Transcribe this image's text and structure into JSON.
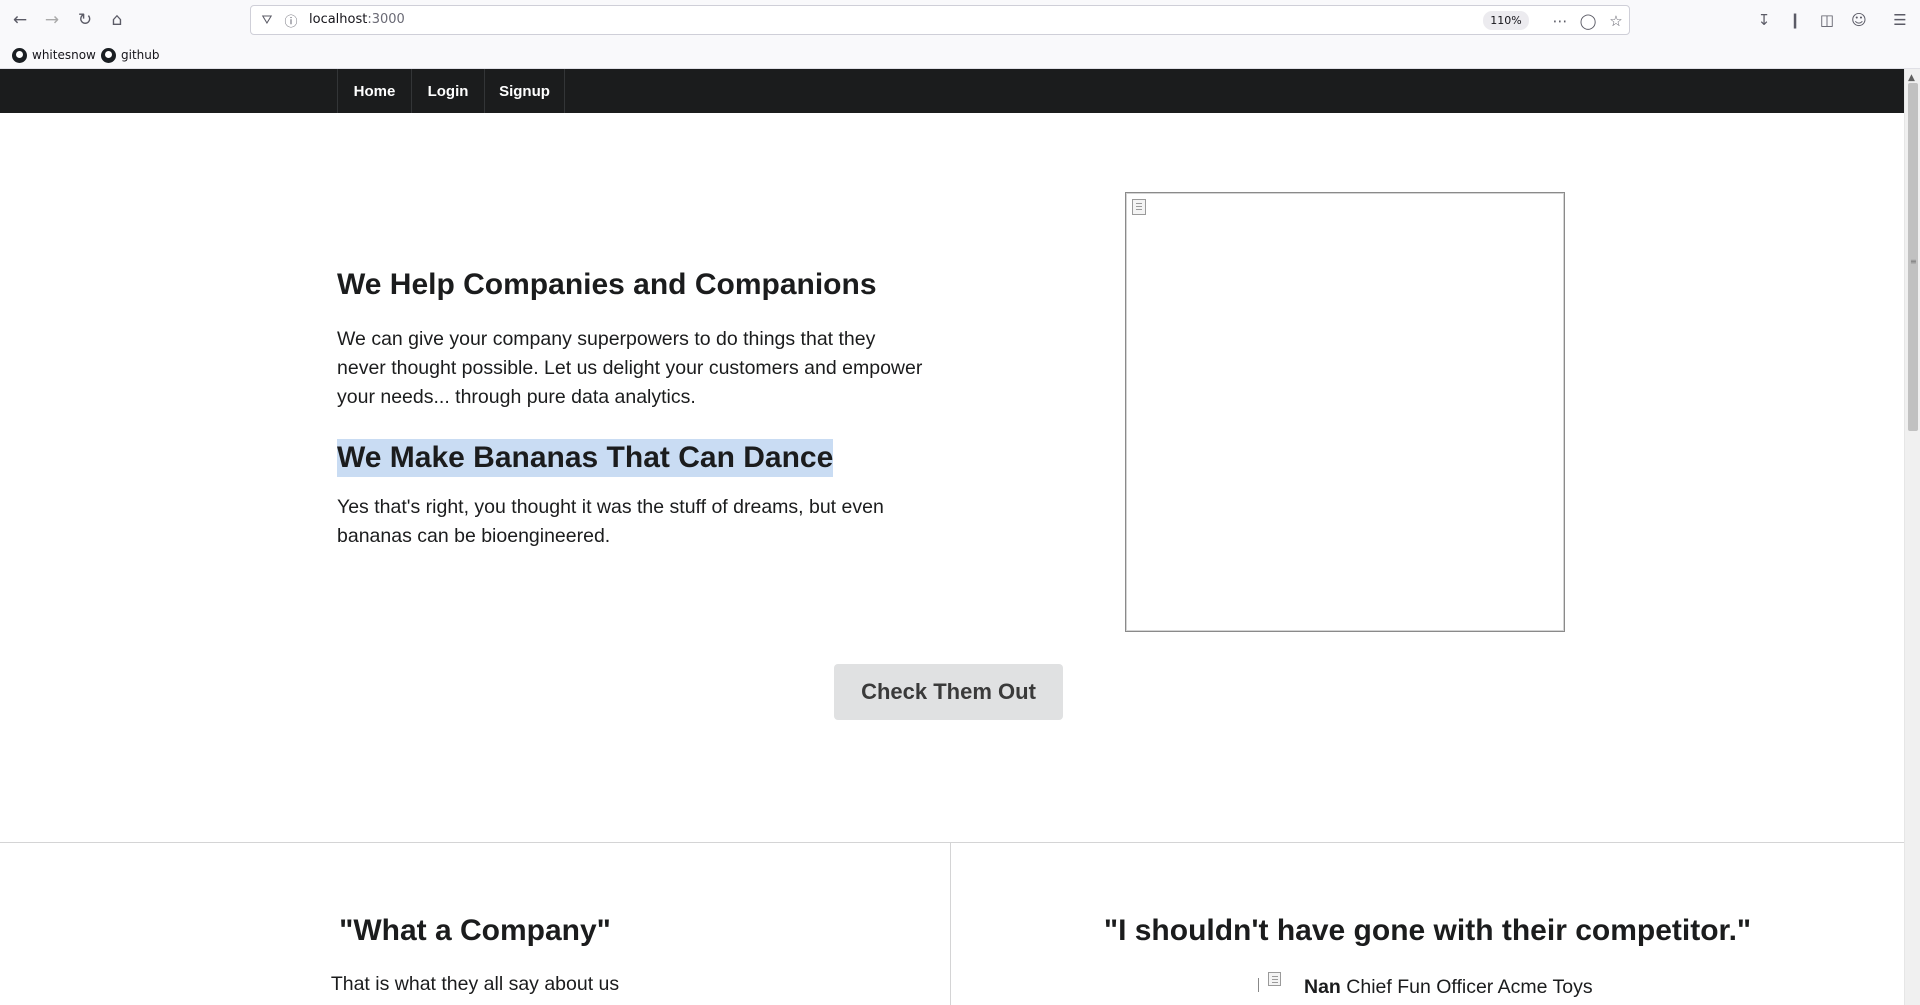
{
  "browser": {
    "url_host": "localhost",
    "url_port": ":3000",
    "zoom": "110%",
    "bookmarks": [
      {
        "label": "whitesnow"
      },
      {
        "label": "github"
      }
    ]
  },
  "nav": {
    "items": [
      {
        "label": "Home"
      },
      {
        "label": "Login"
      },
      {
        "label": "Signup"
      }
    ]
  },
  "hero": {
    "heading1": "We Help Companies and Companions",
    "para1_lines": [
      "We can give your company superpowers to do things that they",
      "never thought possible. Let us delight your customers and empower",
      "your needs... through pure data analytics."
    ],
    "heading2": "We Make Bananas That Can Dance",
    "para2_lines": [
      "Yes that's right, you thought it was the stuff of dreams, but even",
      "bananas can be bioengineered."
    ],
    "cta_label": "Check Them Out"
  },
  "testimonials": {
    "left_quote": "\"What a Company\"",
    "left_sub": "That is what they all say about us",
    "right_quote": "\"I shouldn't have gone with their competitor.\"",
    "right_author_name": "Nan",
    "right_author_title": "Chief Fun Officer Acme Toys"
  }
}
